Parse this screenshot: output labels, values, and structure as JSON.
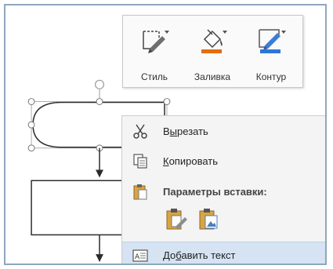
{
  "toolbar": {
    "style_label": "Стиль",
    "fill_label": "Заливка",
    "outline_label": "Контур",
    "fill_color": "#e46c0a",
    "outline_color": "#2e75d6"
  },
  "context_menu": {
    "cut": {
      "before": "В",
      "accel": "ы",
      "after": "резать"
    },
    "copy": {
      "before": "",
      "accel": "К",
      "after": "опировать"
    },
    "paste_options_label": "Параметры вставки:",
    "add_text": {
      "before": "До",
      "accel": "б",
      "after": "авить текст"
    }
  },
  "icons": {
    "style": "shape-style-icon",
    "fill": "paint-bucket-icon",
    "outline": "pen-outline-icon",
    "cut": "scissors-icon",
    "copy": "copy-icon",
    "paste": "clipboard-icon",
    "paste_keep_formatting": "paste-keep-formatting-icon",
    "paste_picture": "paste-picture-icon",
    "add_text": "text-box-icon"
  }
}
